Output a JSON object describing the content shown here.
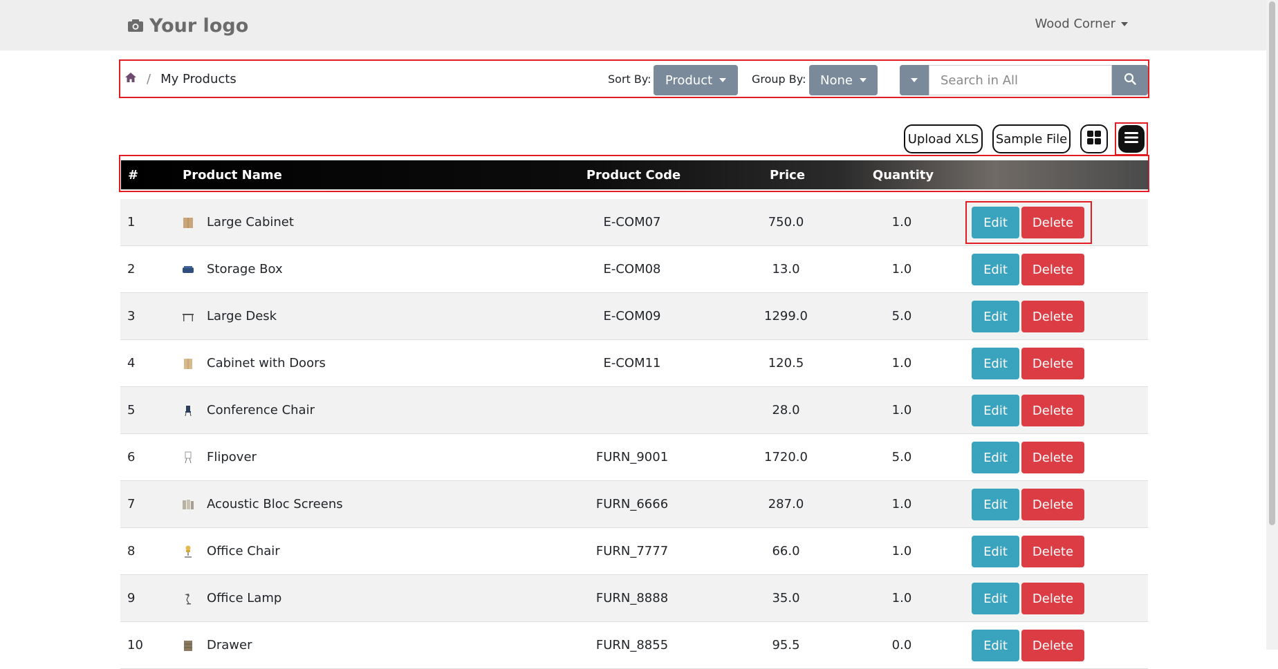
{
  "header": {
    "logo_text": "Your logo",
    "company": "Wood Corner"
  },
  "toolbar": {
    "breadcrumb_current": "My Products",
    "breadcrumb_sep": "/",
    "sort_label": "Sort By:",
    "sort_value": "Product",
    "group_label": "Group By:",
    "group_value": "None",
    "search_placeholder": "Search in All"
  },
  "actions": {
    "upload": "Upload XLS",
    "sample": "Sample File"
  },
  "table": {
    "columns": [
      "#",
      "Product Name",
      "Product Code",
      "Price",
      "Quantity"
    ],
    "edit_label": "Edit",
    "delete_label": "Delete",
    "rows": [
      {
        "num": "1",
        "name": "Large Cabinet",
        "code": "E-COM07",
        "price": "750.0",
        "qty": "1.0"
      },
      {
        "num": "2",
        "name": "Storage Box",
        "code": "E-COM08",
        "price": "13.0",
        "qty": "1.0"
      },
      {
        "num": "3",
        "name": "Large Desk",
        "code": "E-COM09",
        "price": "1299.0",
        "qty": "5.0"
      },
      {
        "num": "4",
        "name": "Cabinet with Doors",
        "code": "E-COM11",
        "price": "120.5",
        "qty": "1.0"
      },
      {
        "num": "5",
        "name": "Conference Chair",
        "code": "",
        "price": "28.0",
        "qty": "1.0"
      },
      {
        "num": "6",
        "name": "Flipover",
        "code": "FURN_9001",
        "price": "1720.0",
        "qty": "5.0"
      },
      {
        "num": "7",
        "name": "Acoustic Bloc Screens",
        "code": "FURN_6666",
        "price": "287.0",
        "qty": "1.0"
      },
      {
        "num": "8",
        "name": "Office Chair",
        "code": "FURN_7777",
        "price": "66.0",
        "qty": "1.0"
      },
      {
        "num": "9",
        "name": "Office Lamp",
        "code": "FURN_8888",
        "price": "35.0",
        "qty": "1.0"
      },
      {
        "num": "10",
        "name": "Drawer",
        "code": "FURN_8855",
        "price": "95.5",
        "qty": "0.0"
      }
    ]
  }
}
